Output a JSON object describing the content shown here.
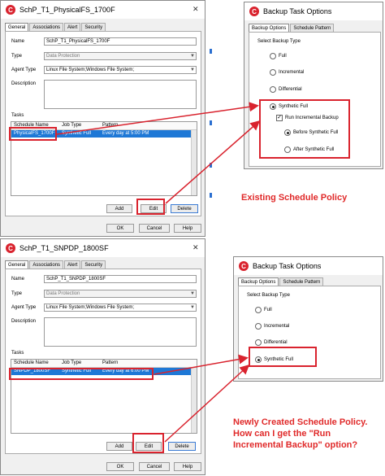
{
  "top": {
    "dialog": {
      "title": "SchP_T1_PhysicalFS_1700F",
      "tabs": [
        "General",
        "Associations",
        "Alert",
        "Security"
      ],
      "labels": {
        "name": "Name",
        "type": "Type",
        "agent": "Agent Type",
        "description": "Description",
        "tasks": "Tasks"
      },
      "values": {
        "name": "SchP_T1_PhysicalFS_1700F",
        "type": "Data Protection",
        "agent": "Linux File System;Windows File System;"
      },
      "table_headers": [
        "Schedule Name",
        "Job Type",
        "Pattern"
      ],
      "row": [
        "PhysicalFS_1700F",
        "Synthetic Full",
        "Every day at 5:00 PM"
      ],
      "buttons": {
        "add": "Add",
        "edit": "Edit",
        "delete": "Delete",
        "ok": "OK",
        "cancel": "Cancel",
        "help": "Help"
      }
    },
    "options": {
      "title": "Backup Task Options",
      "tabs": [
        "Backup Options",
        "Schedule Pattern"
      ],
      "group": "Select Backup Type",
      "choices": [
        "Full",
        "Incremental",
        "Differential",
        "Synthetic Full"
      ],
      "run_incremental": "Run Incremental Backup",
      "sub": [
        "Before Synthetic Full",
        "After Synthetic Full"
      ]
    },
    "note": "Existing Schedule Policy"
  },
  "bottom": {
    "dialog": {
      "title": "SchP_T1_SNPDP_1800SF",
      "tabs": [
        "General",
        "Associations",
        "Alert",
        "Security"
      ],
      "labels": {
        "name": "Name",
        "type": "Type",
        "agent": "Agent Type",
        "description": "Description",
        "tasks": "Tasks"
      },
      "values": {
        "name": "SchP_T1_SNPDP_1800SF",
        "type": "Data Protection",
        "agent": "Linux File System;Windows File System;"
      },
      "table_headers": [
        "Schedule Name",
        "Job Type",
        "Pattern"
      ],
      "row": [
        "SNPDP_1800SF",
        "Synthetic Full",
        "Every day at 6:00 PM"
      ],
      "buttons": {
        "add": "Add",
        "edit": "Edit",
        "delete": "Delete",
        "ok": "OK",
        "cancel": "Cancel",
        "help": "Help"
      }
    },
    "options": {
      "title": "Backup Task Options",
      "tabs": [
        "Backup Options",
        "Schedule Pattern"
      ],
      "group": "Select Backup Type",
      "choices": [
        "Full",
        "Incremental",
        "Differential",
        "Synthetic Full"
      ]
    },
    "note": "Newly Created Schedule Policy. How can I get the \"Run Incremental Backup\" option?"
  },
  "colors": {
    "accent_red": "#d9232e",
    "selection_blue": "#1e78d6",
    "note_red": "#e02a2a"
  }
}
